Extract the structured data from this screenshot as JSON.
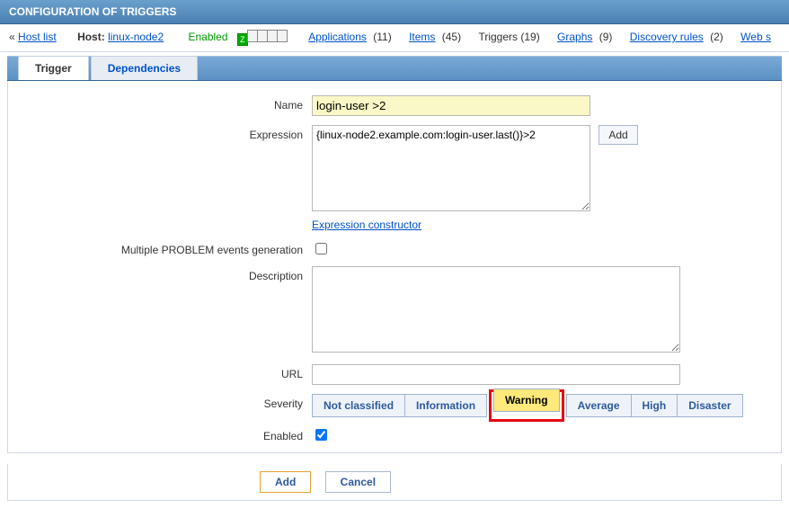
{
  "page": {
    "title": "CONFIGURATION OF TRIGGERS"
  },
  "breadcrumb": {
    "back_marker": "«",
    "host_list": "Host list",
    "host_label": "Host:",
    "host_name": "linux-node2",
    "status": "Enabled",
    "applications_label": "Applications",
    "applications_count": "(11)",
    "items_label": "Items",
    "items_count": "(45)",
    "triggers_label": "Triggers",
    "triggers_count": "(19)",
    "graphs_label": "Graphs",
    "graphs_count": "(9)",
    "discovery_label": "Discovery rules",
    "discovery_count": "(2)",
    "web_label": "Web s"
  },
  "tabs": {
    "trigger": "Trigger",
    "dependencies": "Dependencies"
  },
  "form": {
    "name_label": "Name",
    "name_value": "login-user >2",
    "expression_label": "Expression",
    "expression_value": "{linux-node2.example.com:login-user.last()}>2",
    "add_button": "Add",
    "expr_constructor": "Expression constructor",
    "multiple_label": "Multiple PROBLEM events generation",
    "description_label": "Description",
    "description_value": "",
    "url_label": "URL",
    "url_value": "",
    "severity_label": "Severity",
    "severity": {
      "not_classified": "Not classified",
      "information": "Information",
      "warning": "Warning",
      "average": "Average",
      "high": "High",
      "disaster": "Disaster"
    },
    "enabled_label": "Enabled"
  },
  "footer": {
    "add": "Add",
    "cancel": "Cancel"
  }
}
